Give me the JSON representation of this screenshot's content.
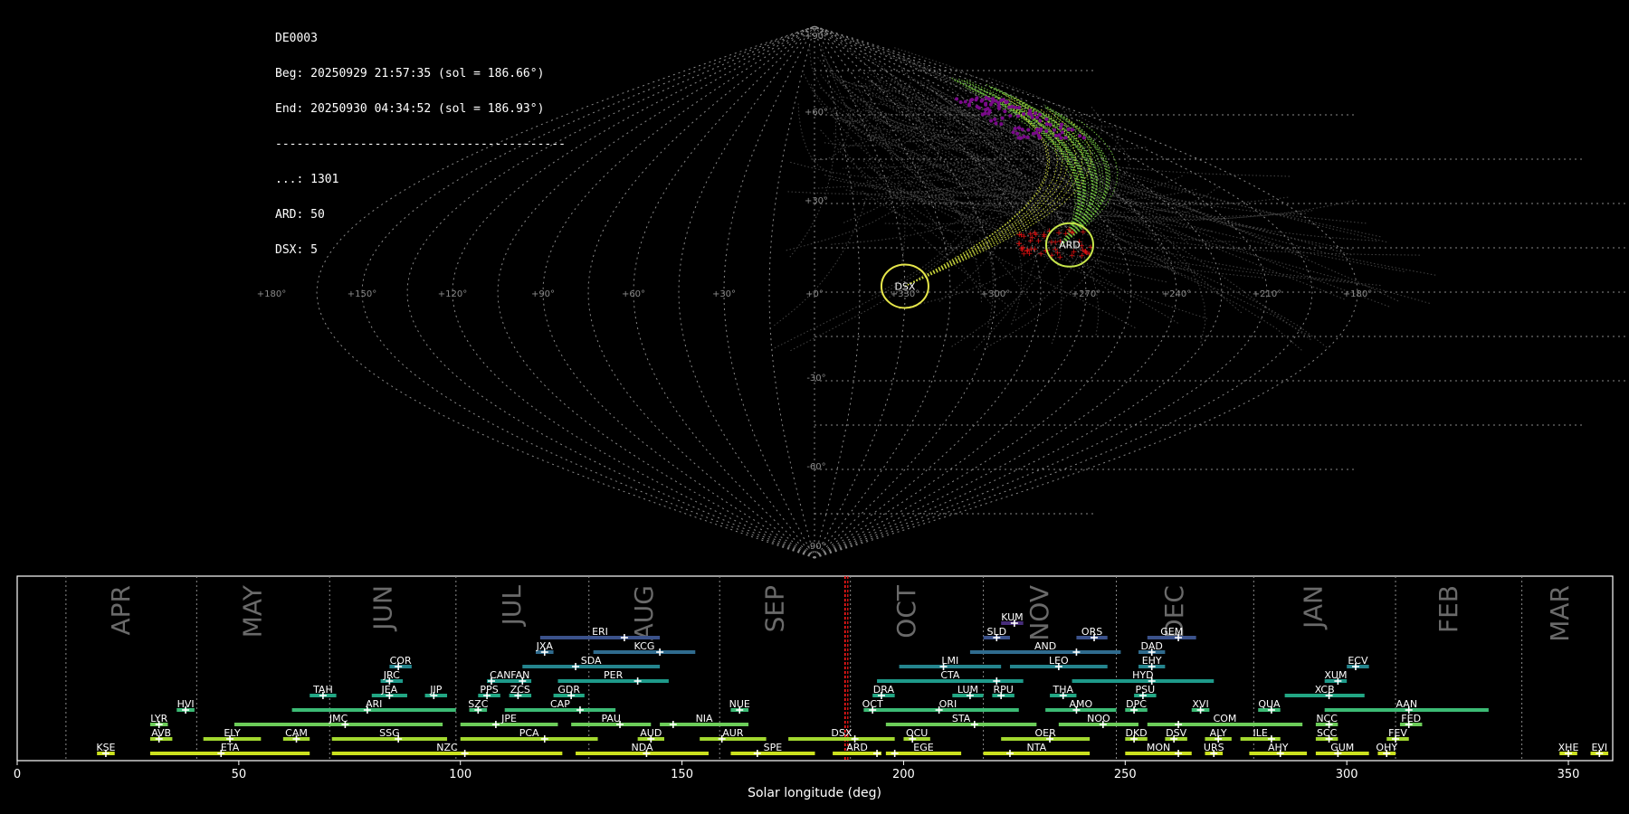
{
  "info": {
    "station": "DE0003",
    "begin": "Beg: 20250929 21:57:35 (sol = 186.66°)",
    "end": "End: 20250930 04:34:52 (sol = 186.93°)",
    "divider": "-----------------------------------------",
    "counts": [
      "...: 1301",
      "ARD: 50",
      "DSX: 5"
    ]
  },
  "sky_map": {
    "lon_ticks": [
      "+180°",
      "+150°",
      "+120°",
      "+90°",
      "+60°",
      "+30°",
      "+0°",
      "+330°",
      "+300°",
      "+270°",
      "+240°",
      "+210°",
      "+180°"
    ],
    "lat_ticks": [
      "+90°",
      "+60°",
      "+30°",
      "-30°",
      "-60°",
      "-90°"
    ],
    "showers_marked": [
      {
        "code": "ARD",
        "lon": 92,
        "lat": 16,
        "ring_color": "#c8e64a"
      },
      {
        "code": "DSX",
        "lon": 150,
        "lat": 2,
        "ring_color": "#e6e64a"
      }
    ],
    "colors": {
      "grid": "#888888",
      "sporadic": "#7a7a7a",
      "ard": "#6fbf3f",
      "dsx": "#c8d43a",
      "radiants": "#e01010",
      "purple": "#7a0a8a"
    }
  },
  "chart_data": {
    "type": "timeline",
    "xlabel": "Solar longitude (deg)",
    "xlim": [
      0,
      360
    ],
    "x_ticks": [
      0,
      50,
      100,
      150,
      200,
      250,
      300,
      350
    ],
    "current_sol": 186.8,
    "months": [
      {
        "name": "APR",
        "boundary": 11
      },
      {
        "name": "MAY",
        "boundary": 40.5
      },
      {
        "name": "JUN",
        "boundary": 70.5
      },
      {
        "name": "JUL",
        "boundary": 99
      },
      {
        "name": "AUG",
        "boundary": 129
      },
      {
        "name": "SEP",
        "boundary": 158.5
      },
      {
        "name": "OCT",
        "boundary": 188
      },
      {
        "name": "NOV",
        "boundary": 218
      },
      {
        "name": "DEC",
        "boundary": 248
      },
      {
        "name": "JAN",
        "boundary": 279
      },
      {
        "name": "FEB",
        "boundary": 311
      },
      {
        "name": "MAR",
        "boundary": 339.5
      }
    ],
    "showers": [
      {
        "code": "KSE",
        "start": 18,
        "end": 22,
        "peak": 20,
        "row": 0
      },
      {
        "code": "ETA",
        "start": 30,
        "end": 66,
        "peak": 46,
        "row": 0
      },
      {
        "code": "NZC",
        "start": 71,
        "end": 123,
        "peak": 101,
        "row": 0
      },
      {
        "code": "NDA",
        "start": 126,
        "end": 156,
        "peak": 142,
        "row": 0
      },
      {
        "code": "SPE",
        "start": 161,
        "end": 180,
        "peak": 167,
        "row": 0
      },
      {
        "code": "ARD",
        "start": 184,
        "end": 195,
        "peak": 194,
        "row": 0
      },
      {
        "code": "EGE",
        "start": 196,
        "end": 213,
        "peak": 198,
        "row": 0
      },
      {
        "code": "NTA",
        "start": 218,
        "end": 242,
        "peak": 224,
        "row": 0
      },
      {
        "code": "MON",
        "start": 250,
        "end": 265,
        "peak": 262,
        "row": 0
      },
      {
        "code": "URS",
        "start": 268,
        "end": 272,
        "peak": 270,
        "row": 0
      },
      {
        "code": "AHY",
        "start": 278,
        "end": 291,
        "peak": 285,
        "row": 0
      },
      {
        "code": "GUM",
        "start": 293,
        "end": 305,
        "peak": 298,
        "row": 0
      },
      {
        "code": "OHY",
        "start": 307,
        "end": 311,
        "peak": 309,
        "row": 0
      },
      {
        "code": "XHE",
        "start": 348,
        "end": 352,
        "peak": 350,
        "row": 0
      },
      {
        "code": "EVI",
        "start": 355,
        "end": 359,
        "peak": 357,
        "row": 0
      },
      {
        "code": "AVB",
        "start": 30,
        "end": 35,
        "peak": 32,
        "row": 1
      },
      {
        "code": "ELY",
        "start": 42,
        "end": 55,
        "peak": 48,
        "row": 1
      },
      {
        "code": "CAM",
        "start": 60,
        "end": 66,
        "peak": 63,
        "row": 1
      },
      {
        "code": "SSG",
        "start": 71,
        "end": 97,
        "peak": 86,
        "row": 1
      },
      {
        "code": "PCA",
        "start": 100,
        "end": 131,
        "peak": 119,
        "row": 1
      },
      {
        "code": "AUD",
        "start": 140,
        "end": 146,
        "peak": 143,
        "row": 1
      },
      {
        "code": "AUR",
        "start": 154,
        "end": 169,
        "peak": 159,
        "row": 1
      },
      {
        "code": "DSX",
        "start": 174,
        "end": 198,
        "peak": 189,
        "row": 1
      },
      {
        "code": "OCU",
        "start": 200,
        "end": 206,
        "peak": 202,
        "row": 1
      },
      {
        "code": "OER",
        "start": 222,
        "end": 242,
        "peak": 233,
        "row": 1
      },
      {
        "code": "DKD",
        "start": 250,
        "end": 255,
        "peak": 252,
        "row": 1
      },
      {
        "code": "DSV",
        "start": 259,
        "end": 264,
        "peak": 261,
        "row": 1
      },
      {
        "code": "ALY",
        "start": 268,
        "end": 274,
        "peak": 271,
        "row": 1
      },
      {
        "code": "ILE",
        "start": 276,
        "end": 285,
        "peak": 283,
        "row": 1
      },
      {
        "code": "SCC",
        "start": 293,
        "end": 298,
        "peak": 296,
        "row": 1
      },
      {
        "code": "FEV",
        "start": 309,
        "end": 314,
        "peak": 311,
        "row": 1
      },
      {
        "code": "LYR",
        "start": 30,
        "end": 34,
        "peak": 32,
        "row": 2
      },
      {
        "code": "JMC",
        "start": 49,
        "end": 96,
        "peak": 74,
        "row": 2
      },
      {
        "code": "JPE",
        "start": 100,
        "end": 122,
        "peak": 108,
        "row": 2
      },
      {
        "code": "PAU",
        "start": 125,
        "end": 143,
        "peak": 136,
        "row": 2
      },
      {
        "code": "NIA",
        "start": 145,
        "end": 165,
        "peak": 148,
        "row": 2
      },
      {
        "code": "STA",
        "start": 196,
        "end": 230,
        "peak": 216,
        "row": 2
      },
      {
        "code": "NOO",
        "start": 235,
        "end": 253,
        "peak": 245,
        "row": 2
      },
      {
        "code": "COM",
        "start": 255,
        "end": 290,
        "peak": 262,
        "row": 2
      },
      {
        "code": "NCC",
        "start": 293,
        "end": 298,
        "peak": 296,
        "row": 2
      },
      {
        "code": "FED",
        "start": 312,
        "end": 317,
        "peak": 314,
        "row": 2
      },
      {
        "code": "HVI",
        "start": 36,
        "end": 40,
        "peak": 38,
        "row": 3
      },
      {
        "code": "ARI",
        "start": 62,
        "end": 99,
        "peak": 79,
        "row": 3
      },
      {
        "code": "SZC",
        "start": 102,
        "end": 106,
        "peak": 104,
        "row": 3
      },
      {
        "code": "CAP",
        "start": 110,
        "end": 135,
        "peak": 127,
        "row": 3
      },
      {
        "code": "NUE",
        "start": 161,
        "end": 165,
        "peak": 163,
        "row": 3
      },
      {
        "code": "OCT",
        "start": 191,
        "end": 195,
        "peak": 193,
        "row": 3
      },
      {
        "code": "ORI",
        "start": 194,
        "end": 226,
        "peak": 208,
        "row": 3
      },
      {
        "code": "AMO",
        "start": 232,
        "end": 248,
        "peak": 239,
        "row": 3
      },
      {
        "code": "DPC",
        "start": 250,
        "end": 255,
        "peak": 252,
        "row": 3
      },
      {
        "code": "XVI",
        "start": 265,
        "end": 269,
        "peak": 267,
        "row": 3
      },
      {
        "code": "QUA",
        "start": 280,
        "end": 285,
        "peak": 283,
        "row": 3
      },
      {
        "code": "AAN",
        "start": 295,
        "end": 332,
        "peak": 314,
        "row": 3
      },
      {
        "code": "TAH",
        "start": 66,
        "end": 72,
        "peak": 69,
        "row": 4
      },
      {
        "code": "JEA",
        "start": 80,
        "end": 88,
        "peak": 84,
        "row": 4
      },
      {
        "code": "JIP",
        "start": 92,
        "end": 97,
        "peak": 94,
        "row": 4
      },
      {
        "code": "PPS",
        "start": 104,
        "end": 109,
        "peak": 106,
        "row": 4
      },
      {
        "code": "ZCS",
        "start": 111,
        "end": 116,
        "peak": 113,
        "row": 4
      },
      {
        "code": "GDR",
        "start": 121,
        "end": 128,
        "peak": 125,
        "row": 4
      },
      {
        "code": "DRA",
        "start": 193,
        "end": 198,
        "peak": 195,
        "row": 4
      },
      {
        "code": "LUM",
        "start": 211,
        "end": 218,
        "peak": 215,
        "row": 4
      },
      {
        "code": "RPU",
        "start": 220,
        "end": 225,
        "peak": 222,
        "row": 4
      },
      {
        "code": "THA",
        "start": 233,
        "end": 239,
        "peak": 236,
        "row": 4
      },
      {
        "code": "PSU",
        "start": 252,
        "end": 257,
        "peak": 254,
        "row": 4
      },
      {
        "code": "XCB",
        "start": 286,
        "end": 304,
        "peak": 296,
        "row": 4
      },
      {
        "code": "JRC",
        "start": 82,
        "end": 87,
        "peak": 84,
        "row": 5
      },
      {
        "code": "CAN",
        "start": 106,
        "end": 112,
        "peak": 107,
        "row": 5
      },
      {
        "code": "FAN",
        "start": 111,
        "end": 116,
        "peak": 114,
        "row": 5
      },
      {
        "code": "PER",
        "start": 122,
        "end": 147,
        "peak": 140,
        "row": 5
      },
      {
        "code": "CTA",
        "start": 194,
        "end": 227,
        "peak": 221,
        "row": 5
      },
      {
        "code": "HYD",
        "start": 238,
        "end": 270,
        "peak": 256,
        "row": 5
      },
      {
        "code": "XUM",
        "start": 295,
        "end": 300,
        "peak": 298,
        "row": 5
      },
      {
        "code": "COR",
        "start": 84,
        "end": 89,
        "peak": 86,
        "row": 6
      },
      {
        "code": "SDA",
        "start": 114,
        "end": 145,
        "peak": 126,
        "row": 6
      },
      {
        "code": "LMI",
        "start": 199,
        "end": 222,
        "peak": 209,
        "row": 6
      },
      {
        "code": "LEO",
        "start": 224,
        "end": 246,
        "peak": 235,
        "row": 6
      },
      {
        "code": "EHY",
        "start": 253,
        "end": 259,
        "peak": 256,
        "row": 6
      },
      {
        "code": "ECV",
        "start": 300,
        "end": 305,
        "peak": 302,
        "row": 6
      },
      {
        "code": "JXA",
        "start": 117,
        "end": 121,
        "peak": 119,
        "row": 7
      },
      {
        "code": "KCG",
        "start": 130,
        "end": 153,
        "peak": 145,
        "row": 7
      },
      {
        "code": "AND",
        "start": 215,
        "end": 249,
        "peak": 239,
        "row": 7
      },
      {
        "code": "DAD",
        "start": 253,
        "end": 259,
        "peak": 256,
        "row": 7
      },
      {
        "code": "ERI",
        "start": 118,
        "end": 145,
        "peak": 137,
        "row": 8
      },
      {
        "code": "SLD",
        "start": 218,
        "end": 224,
        "peak": 221,
        "row": 8
      },
      {
        "code": "ORS",
        "start": 239,
        "end": 246,
        "peak": 243,
        "row": 8
      },
      {
        "code": "GEM",
        "start": 255,
        "end": 266,
        "peak": 262,
        "row": 8
      },
      {
        "code": "KUM",
        "start": 222,
        "end": 227,
        "peak": 225,
        "row": 9
      }
    ]
  }
}
